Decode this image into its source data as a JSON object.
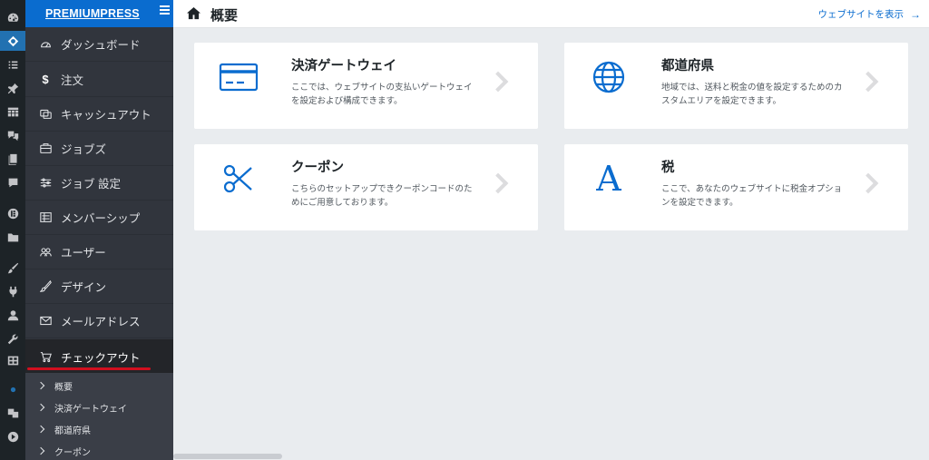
{
  "brand": {
    "name": "PREMIUMPRESS"
  },
  "header": {
    "title": "概要",
    "view_site": "ウェブサイトを表示",
    "view_site_arrow": "→"
  },
  "sidebar": {
    "items": [
      {
        "label": "ダッシュボード",
        "icon": "dashboard-gauge-icon"
      },
      {
        "label": "注文",
        "icon": "dollar-icon",
        "glyph": "$"
      },
      {
        "label": "キャッシュアウト",
        "icon": "cashout-icon"
      },
      {
        "label": "ジョブズ",
        "icon": "briefcase-icon"
      },
      {
        "label": "ジョブ 設定",
        "icon": "settings-sliders-icon"
      },
      {
        "label": "メンバーシップ",
        "icon": "membership-icon"
      },
      {
        "label": "ユーザー",
        "icon": "users-icon"
      },
      {
        "label": "デザイン",
        "icon": "brush-icon"
      },
      {
        "label": "メールアドレス",
        "icon": "envelope-icon"
      },
      {
        "label": "チェックアウト",
        "icon": "cart-icon",
        "current": true
      }
    ],
    "submenu": [
      {
        "label": "概要"
      },
      {
        "label": "決済ゲートウェイ"
      },
      {
        "label": "都道府県"
      },
      {
        "label": "クーポン"
      }
    ]
  },
  "cards": [
    {
      "title": "決済ゲートウェイ",
      "desc": "ここでは、ウェブサイトの支払いゲートウェイを設定および構成できます。",
      "icon": "credit-card-icon"
    },
    {
      "title": "都道府県",
      "desc": "地域では、送料と税金の値を設定するためのカスタムエリアを設定できます。",
      "icon": "globe-icon"
    },
    {
      "title": "クーポン",
      "desc": "こちらのセットアップできクーポンコードのためにご用意しております。",
      "icon": "scissors-icon"
    },
    {
      "title": "税",
      "desc": "ここで、あなたのウェブサイトに税金オプションを設定できます。",
      "icon": "letter-a-icon",
      "glyph": "A"
    }
  ],
  "colors": {
    "accent": "#0a6ccf",
    "sidebar_bg": "#31353d",
    "wp_bar": "#1d2327",
    "active_underline": "#d10f1f",
    "content_bg": "#e9ecef"
  }
}
